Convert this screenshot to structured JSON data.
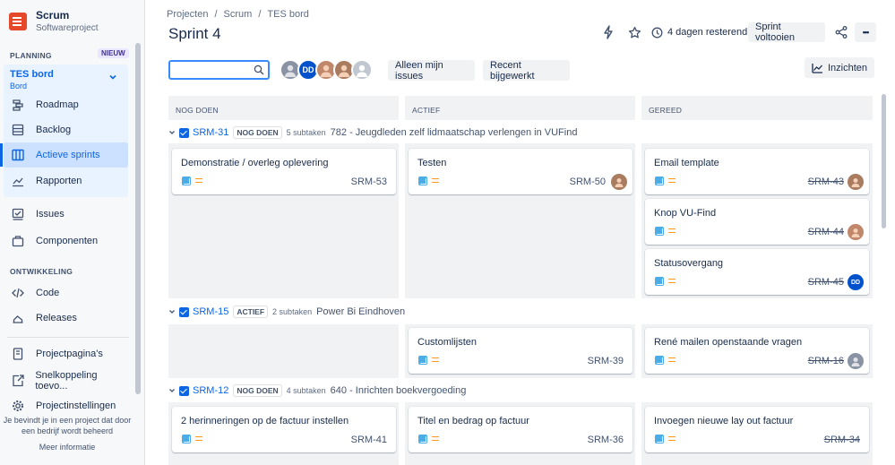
{
  "sidebar": {
    "project_name": "Scrum",
    "project_type": "Softwareproject",
    "planning_label": "PLANNING",
    "new_badge": "NIEUW",
    "board_name": "TES bord",
    "board_sub": "Bord",
    "items": [
      {
        "label": "Roadmap",
        "icon": "roadmap-icon"
      },
      {
        "label": "Backlog",
        "icon": "backlog-icon"
      },
      {
        "label": "Actieve sprints",
        "icon": "board-icon"
      },
      {
        "label": "Rapporten",
        "icon": "chart-icon"
      },
      {
        "label": "Issues",
        "icon": "issues-icon"
      },
      {
        "label": "Componenten",
        "icon": "components-icon"
      }
    ],
    "dev_label": "ONTWIKKELING",
    "dev_items": [
      {
        "label": "Code",
        "icon": "code-icon"
      },
      {
        "label": "Releases",
        "icon": "releases-icon"
      }
    ],
    "bottom_items": [
      {
        "label": "Projectpagina's",
        "icon": "page-icon"
      },
      {
        "label": "Snelkoppeling toevo...",
        "icon": "shortcut-icon"
      },
      {
        "label": "Projectinstellingen",
        "icon": "settings-icon"
      }
    ],
    "footer_text": "Je bevindt je in een project dat door een bedrijf wordt beheerd",
    "footer_link": "Meer informatie"
  },
  "breadcrumb": [
    "Projecten",
    "Scrum",
    "TES bord"
  ],
  "title": "Sprint 4",
  "days_remaining": "4 dagen resterend",
  "complete_sprint": "Sprint voltooien",
  "more_glyph": "•••",
  "filters": {
    "search_placeholder": "",
    "only_my_issues": "Alleen mijn issues",
    "recently_updated": "Recent bijgewerkt",
    "insights": "Inzichten"
  },
  "avatars": [
    {
      "initials": "",
      "color": "#8993a4"
    },
    {
      "initials": "DD",
      "color": "#0052cc"
    },
    {
      "initials": "",
      "color": "#c1876b"
    },
    {
      "initials": "",
      "color": "#a97b5f"
    },
    {
      "initials": "",
      "color": "#c1c7d0"
    }
  ],
  "columns": [
    "NOG DOEN",
    "ACTIEF",
    "GEREED"
  ],
  "lanes": [
    {
      "key": "SRM-31",
      "status": "NOG DOEN",
      "subtasks": "5 subtaken",
      "title": "782 - Jeugdleden zelf lidmaatschap verlengen in VUFind",
      "cards": [
        {
          "col": 0,
          "title": "Demonstratie / overleg oplevering",
          "key": "SRM-53",
          "done": false,
          "avatar": ""
        },
        {
          "col": 1,
          "title": "Testen",
          "key": "SRM-50",
          "done": false,
          "avatar": "#a97b5f"
        },
        {
          "col": 2,
          "title": "Email template",
          "key": "SRM-43",
          "done": true,
          "avatar": "#a97b5f"
        },
        {
          "col": 2,
          "title": "Knop VU-Find",
          "key": "SRM-44",
          "done": true,
          "avatar": "#c1876b"
        },
        {
          "col": 2,
          "title": "Statusovergang",
          "key": "SRM-45",
          "done": true,
          "avatar": "#0052cc",
          "avatar_initials": "DD"
        }
      ]
    },
    {
      "key": "SRM-15",
      "status": "ACTIEF",
      "subtasks": "2 subtaken",
      "title": "Power Bi Eindhoven",
      "cards": [
        {
          "col": 1,
          "title": "Customlijsten",
          "key": "SRM-39",
          "done": false,
          "avatar": ""
        },
        {
          "col": 2,
          "title": "René mailen openstaande vragen",
          "key": "SRM-16",
          "done": true,
          "avatar": "#8993a4"
        }
      ]
    },
    {
      "key": "SRM-12",
      "status": "NOG DOEN",
      "subtasks": "4 subtaken",
      "title": "640 - Inrichten boekvergoeding",
      "cards": [
        {
          "col": 0,
          "title": "2 herinneringen op de factuur instellen",
          "key": "SRM-41",
          "done": false,
          "avatar": ""
        },
        {
          "col": 1,
          "title": "Titel en bedrag op factuur",
          "key": "SRM-36",
          "done": false,
          "avatar": ""
        },
        {
          "col": 2,
          "title": "Invoegen nieuwe lay out factuur",
          "key": "SRM-34",
          "done": true,
          "avatar": ""
        }
      ]
    }
  ]
}
